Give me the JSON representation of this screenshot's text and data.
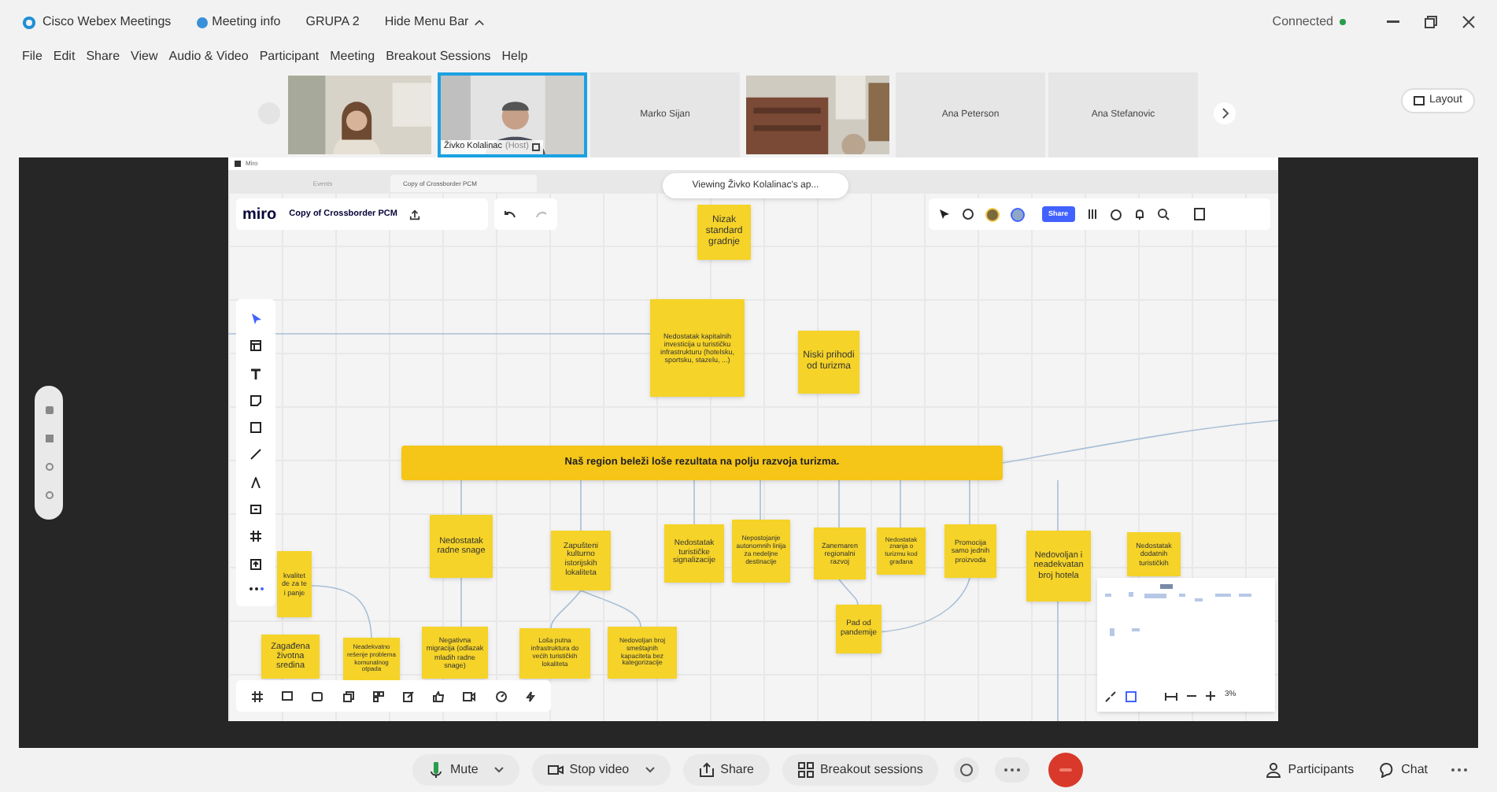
{
  "app": {
    "title": "Cisco Webex Meetings",
    "meeting_info": "Meeting info",
    "group": "GRUPA 2",
    "hide_menu": "Hide Menu Bar",
    "status": "Connected"
  },
  "menu": [
    "File",
    "Edit",
    "Share",
    "View",
    "Audio & Video",
    "Participant",
    "Meeting",
    "Breakout Sessions",
    "Help"
  ],
  "participants": [
    {
      "kind": "video",
      "selected": false
    },
    {
      "kind": "video",
      "selected": true,
      "name": "Živko Kolalinac",
      "role": "(Host)"
    },
    {
      "kind": "name",
      "selected": false,
      "name": "Marko Sijan"
    },
    {
      "kind": "video",
      "selected": false
    },
    {
      "kind": "name",
      "selected": false,
      "name": "Ana Peterson"
    },
    {
      "kind": "name",
      "selected": false,
      "name": "Ana Stefanovic"
    }
  ],
  "layout_button": "Layout",
  "miro": {
    "window_title": "Miro",
    "tabs": [
      {
        "label": "Events",
        "selected": false
      },
      {
        "label": "Copy of Crossborder PCM",
        "selected": true
      }
    ],
    "viewing": "Viewing Živko Kolalinac's ap...",
    "logo": "miro",
    "board_name": "Copy of Crossborder PCM",
    "share": "Share",
    "zoom": "3%",
    "banner": "Naš region beleži loše rezultata na polju razvoja turizma.",
    "notes": [
      "Nizak standard gradnje",
      "Nedostatak kapitalnih investicija u turističku infrastrukturu (hotelsku, sportsku, stazelu, ...)",
      "Niski prihodi od turizma",
      "kvalitet de za te i panje",
      "Nedostatak radne snage",
      "Zapušteni kulturno istorijskih lokaliteta",
      "Nedostatak turističke signalizacije",
      "Nepostojanje autonomnih linija za nedeljne destinacije",
      "Zanemaren regionalni razvoj",
      "Nedostatak znanja o turizmu kod građana",
      "Promocija samo jednih proizvoda",
      "Nedovoljan i neadekvatan broj hotela",
      "Nedostatak dodatnih turističkih",
      "Pad od pandemije",
      "Zagađena životna sredina",
      "Neadekvatno rešenje problema komunalnog otpada",
      "Negativna migracija (odlazak mladih radne snage)",
      "Loša putna infrastruktura do većih turističkih lokaliteta",
      "Nedovoljan broj smeštajnih kapaciteta bez kategorizacije"
    ]
  },
  "controls": [
    {
      "kind": "mute",
      "label": "Mute"
    },
    {
      "kind": "video",
      "label": "Stop video"
    },
    {
      "kind": "share",
      "label": "Share"
    },
    {
      "kind": "breakout",
      "label": "Breakout sessions"
    }
  ],
  "right_controls": [
    {
      "kind": "participants",
      "label": "Participants"
    },
    {
      "kind": "chat",
      "label": "Chat"
    }
  ]
}
